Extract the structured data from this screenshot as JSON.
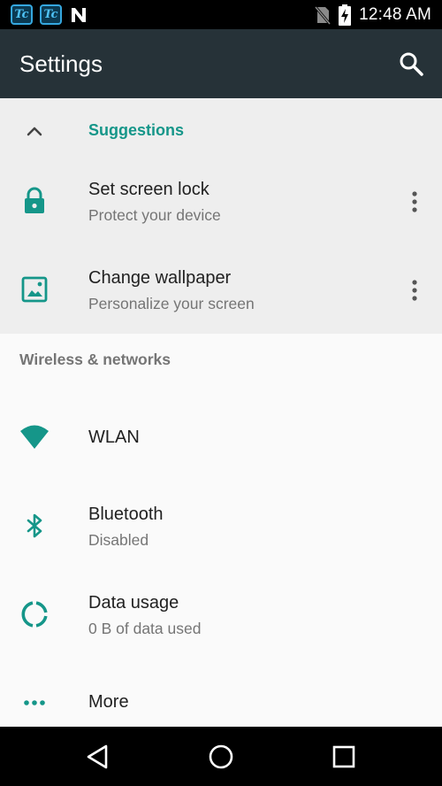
{
  "status_bar": {
    "time": "12:48 AM",
    "left_icons": [
      {
        "name": "tc-app-icon",
        "text": "Tc"
      },
      {
        "name": "tc-app-icon",
        "text": "Tc"
      },
      {
        "name": "n-notification-icon"
      }
    ],
    "right_icons": [
      "no-sim-icon",
      "battery-charging-icon"
    ]
  },
  "app_bar": {
    "title": "Settings",
    "search_icon": "search-icon"
  },
  "suggestions": {
    "header": "Suggestions",
    "collapse_icon": "chevron-up-icon",
    "items": [
      {
        "title": "Set screen lock",
        "subtitle": "Protect your device",
        "icon": "lock-icon"
      },
      {
        "title": "Change wallpaper",
        "subtitle": "Personalize your screen",
        "icon": "wallpaper-icon"
      }
    ]
  },
  "section": {
    "header": "Wireless & networks",
    "items": [
      {
        "title": "WLAN",
        "icon": "wifi-icon"
      },
      {
        "title": "Bluetooth",
        "subtitle": "Disabled",
        "icon": "bluetooth-icon"
      },
      {
        "title": "Data usage",
        "subtitle": "0 B of data used",
        "icon": "data-usage-icon"
      },
      {
        "title": "More",
        "icon": "more-horizontal-icon"
      }
    ]
  },
  "nav_bar": {
    "buttons": [
      "back-icon",
      "home-icon",
      "recents-icon"
    ]
  },
  "colors": {
    "accent": "#159689",
    "app_bar": "#263238",
    "status_bar": "#000000",
    "suggestion_bg": "#eeeeee",
    "page_bg": "#fafafa"
  }
}
